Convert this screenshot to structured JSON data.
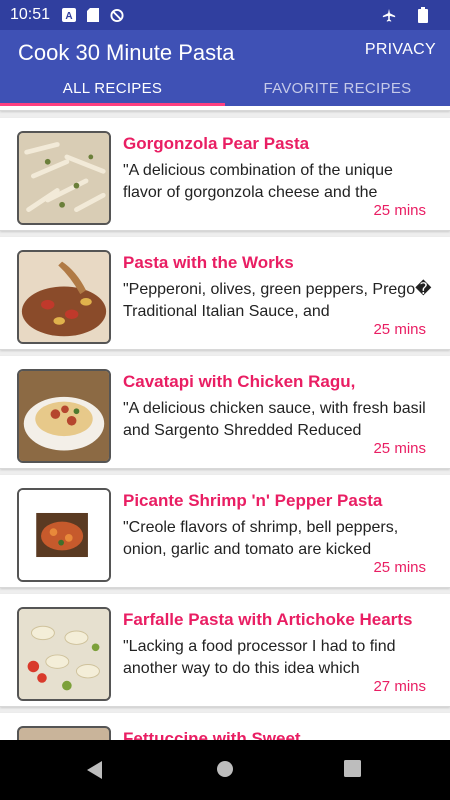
{
  "status_bar": {
    "time": "10:51",
    "icons": [
      "a-icon",
      "sd-card-icon",
      "no-data-icon"
    ],
    "right_icons": [
      "airplane-icon",
      "battery-icon"
    ]
  },
  "app_bar": {
    "title": "Cook 30 Minute Pasta",
    "privacy_label": "PRIVACY"
  },
  "tabs": [
    {
      "label": "ALL RECIPES",
      "selected": true
    },
    {
      "label": "FAVORITE RECIPES",
      "selected": false
    }
  ],
  "recipes": [
    {
      "title": "Gorgonzola Pear Pasta",
      "description": "\"A delicious combination of the unique flavor of gorgonzola cheese and the",
      "time": "25 mins"
    },
    {
      "title": "Pasta with the Works",
      "description": "\"Pepperoni, olives, green peppers, Prego� Traditional Italian Sauce, and",
      "time": "25 mins"
    },
    {
      "title": "Cavatapi with Chicken Ragu,",
      "description": "\"A delicious chicken sauce, with fresh basil and Sargento Shredded Reduced",
      "time": "25 mins"
    },
    {
      "title": "Picante Shrimp 'n' Pepper Pasta",
      "description": "\"Creole flavors of shrimp, bell peppers, onion, garlic and tomato are kicked",
      "time": "25 mins"
    },
    {
      "title": "Farfalle Pasta with Artichoke Hearts",
      "description": "\"Lacking a food processor I had to find another way to do this idea which",
      "time": "27 mins"
    },
    {
      "title": "Fettuccine with Sweet",
      "description": "",
      "time": ""
    }
  ],
  "nav_bar": {
    "buttons": [
      "back-icon",
      "home-icon",
      "recents-icon"
    ]
  },
  "colors": {
    "status_bar": "#303f9f",
    "app_bar": "#3f51b5",
    "accent": "#e91e63",
    "tab_indicator": "#ff4081"
  }
}
